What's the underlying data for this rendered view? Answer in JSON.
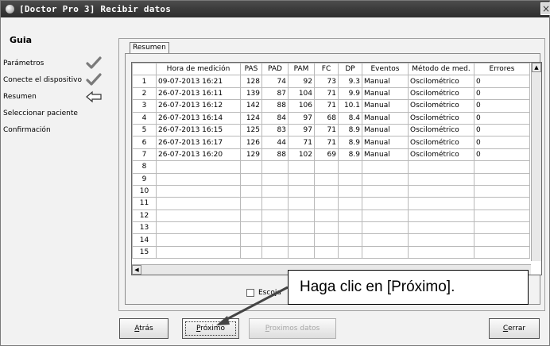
{
  "window": {
    "title": "[Doctor Pro 3] Recibir datos",
    "close_glyph": "×"
  },
  "nav": {
    "title": "Guia",
    "items": [
      {
        "label": "Parámetros",
        "mark": "check"
      },
      {
        "label": "Conecte el dispositivo",
        "mark": "check"
      },
      {
        "label": "Resumen",
        "mark": "arrow-left"
      },
      {
        "label": "Seleccionar paciente",
        "mark": ""
      },
      {
        "label": "Confirmación",
        "mark": ""
      }
    ]
  },
  "tab": {
    "label": "Resumen"
  },
  "grid": {
    "columns": [
      "",
      "Hora de medición",
      "PAS",
      "PAD",
      "PAM",
      "FC",
      "DP",
      "Eventos",
      "Método de med.",
      "Errores"
    ],
    "rows": [
      [
        "1",
        "09-07-2013 16:21",
        "128",
        "74",
        "92",
        "73",
        "9.3",
        "Manual",
        "Oscilométrico",
        "0"
      ],
      [
        "2",
        "26-07-2013 16:11",
        "139",
        "87",
        "104",
        "71",
        "9.9",
        "Manual",
        "Oscilométrico",
        "0"
      ],
      [
        "3",
        "26-07-2013 16:12",
        "142",
        "88",
        "106",
        "71",
        "10.1",
        "Manual",
        "Oscilométrico",
        "0"
      ],
      [
        "4",
        "26-07-2013 16:14",
        "124",
        "84",
        "97",
        "68",
        "8.4",
        "Manual",
        "Oscilométrico",
        "0"
      ],
      [
        "5",
        "26-07-2013 16:15",
        "125",
        "83",
        "97",
        "71",
        "8.9",
        "Manual",
        "Oscilométrico",
        "0"
      ],
      [
        "6",
        "26-07-2013 16:17",
        "126",
        "44",
        "71",
        "71",
        "8.9",
        "Manual",
        "Oscilométrico",
        "0"
      ],
      [
        "7",
        "26-07-2013 16:20",
        "129",
        "88",
        "102",
        "69",
        "8.9",
        "Manual",
        "Oscilométrico",
        "0"
      ],
      [
        "8",
        "",
        "",
        "",
        "",
        "",
        "",
        "",
        "",
        ""
      ],
      [
        "9",
        "",
        "",
        "",
        "",
        "",
        "",
        "",
        "",
        ""
      ],
      [
        "10",
        "",
        "",
        "",
        "",
        "",
        "",
        "",
        "",
        ""
      ],
      [
        "11",
        "",
        "",
        "",
        "",
        "",
        "",
        "",
        "",
        ""
      ],
      [
        "12",
        "",
        "",
        "",
        "",
        "",
        "",
        "",
        "",
        ""
      ],
      [
        "13",
        "",
        "",
        "",
        "",
        "",
        "",
        "",
        "",
        ""
      ],
      [
        "14",
        "",
        "",
        "",
        "",
        "",
        "",
        "",
        "",
        ""
      ],
      [
        "15",
        "",
        "",
        "",
        "",
        "",
        "",
        "",
        "",
        ""
      ]
    ]
  },
  "checkbox": {
    "label": "Escoja",
    "checked": false
  },
  "buttons": {
    "back": {
      "label": "Atrás",
      "accel": "A",
      "rest": "trás"
    },
    "next": {
      "label": "Próximo",
      "accel": "P",
      "rest": "róximo"
    },
    "next_data": {
      "label": "Proximos datos",
      "accel": "P",
      "rest": "roximos datos"
    },
    "close": {
      "label": "Cerrar",
      "accel": "C",
      "rest": "errar"
    }
  },
  "callout": {
    "text": "Haga clic en [Próximo]."
  },
  "colors": {
    "titlebar": "#3b3b3b",
    "window_bg": "#f2f2f2",
    "disabled_text": "#a8a8a8"
  }
}
